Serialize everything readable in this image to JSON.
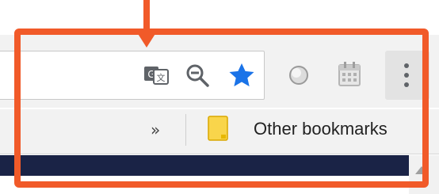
{
  "toolbar": {
    "icons": {
      "translate": "translate-icon",
      "zoom": "zoom-out-icon",
      "bookmark_star": "star-icon",
      "extension": "extension-circle-icon",
      "calendar": "calendar-icon",
      "menu": "kebab-menu-icon"
    }
  },
  "bookmarks_bar": {
    "overflow_chevron": "»",
    "other_bookmarks_label": "Other bookmarks"
  },
  "colors": {
    "highlight": "#f15a29",
    "star": "#1a73e8",
    "page_banner": "#1a2346",
    "folder": "#f9d54b"
  }
}
